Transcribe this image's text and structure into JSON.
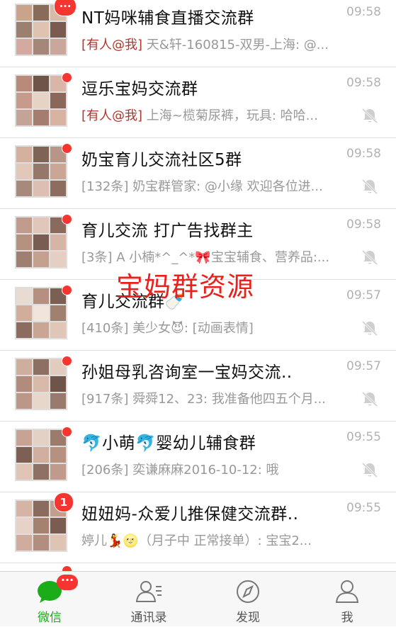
{
  "colors": {
    "accent_green": "#1aad19",
    "badge_red": "#f43530",
    "mention_red": "#b1362d",
    "watermark_red": "#e8211c"
  },
  "watermark": "宝妈群资源",
  "chats": [
    {
      "title": "NT妈咪辅食直播交流群",
      "time": "09:58",
      "mention": "[有人@我]",
      "preview": " 天&轩-160815-双男-上海: @...",
      "badge": "···",
      "muted": false
    },
    {
      "title": "逗乐宝妈交流群",
      "time": "09:58",
      "mention": "[有人@我]",
      "preview": " 上海~榄菊尿裤，玩具: 哈哈...",
      "badge": "",
      "muted": true
    },
    {
      "title": "奶宝育儿交流社区5群",
      "time": "09:58",
      "mention": "",
      "preview": "[132条] 奶宝群管家: @小缘 欢迎各位进...",
      "badge": "",
      "muted": true
    },
    {
      "title": "育儿交流 打广告找群主",
      "time": "09:58",
      "mention": "",
      "preview": "[3条] A 小楠*^_^*🎀宝宝辅食、营养品:...",
      "badge": "",
      "muted": true
    },
    {
      "title": "育儿交流群🍼",
      "time": "09:57",
      "mention": "",
      "preview": "[410条] 美少女😈: [动画表情]",
      "badge": "",
      "muted": true
    },
    {
      "title": "孙姐母乳咨询室一宝妈交流..",
      "time": "09:57",
      "mention": "",
      "preview": "[917条] 舜舜12、23: 我准备他四五个月...",
      "badge": "",
      "muted": true
    },
    {
      "title": "🐬小萌🐬婴幼儿辅食群",
      "time": "09:55",
      "mention": "",
      "preview": "[206条] 奕谦麻麻2016-10-12: 哦",
      "badge": "",
      "muted": true
    },
    {
      "title": "妞妞妈-众爱儿推保健交流群..",
      "time": "09:55",
      "mention": "",
      "preview": "婷儿💃🌝（月子中 正常接单）: 宝宝2...",
      "badge": "1",
      "muted": false
    }
  ],
  "tabbar": {
    "tabs": [
      {
        "label": "微信",
        "icon": "chat-bubble-icon",
        "active": true,
        "badge": "···"
      },
      {
        "label": "通讯录",
        "icon": "contacts-icon",
        "active": false
      },
      {
        "label": "发现",
        "icon": "compass-icon",
        "active": false
      },
      {
        "label": "我",
        "icon": "person-icon",
        "active": false
      }
    ]
  }
}
